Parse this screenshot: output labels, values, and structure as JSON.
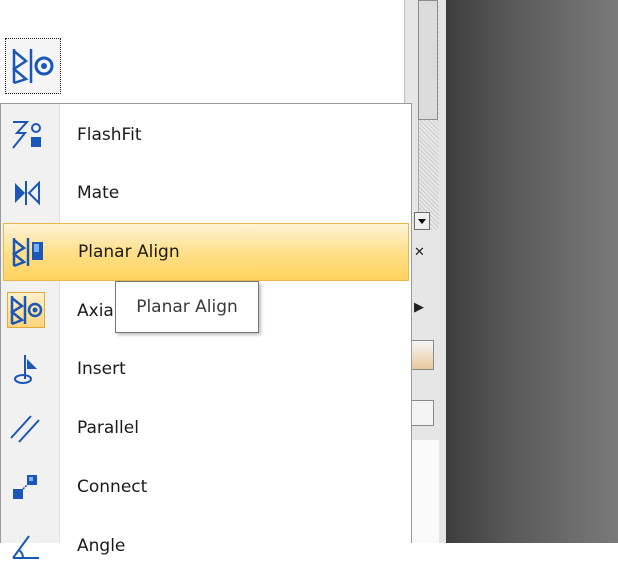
{
  "toolbar": {
    "active_tool_icon": "axial-align-icon"
  },
  "menu": {
    "items": [
      {
        "label": "FlashFit",
        "icon": "flashfit-icon"
      },
      {
        "label": "Mate",
        "icon": "mate-icon"
      },
      {
        "label": "Planar Align",
        "icon": "planar-align-icon"
      },
      {
        "label": "Axia",
        "icon": "axial-align-icon"
      },
      {
        "label": "Insert",
        "icon": "insert-icon"
      },
      {
        "label": "Parallel",
        "icon": "parallel-icon"
      },
      {
        "label": "Connect",
        "icon": "connect-icon"
      },
      {
        "label": "Angle",
        "icon": "angle-icon"
      }
    ],
    "highlighted_index": 2
  },
  "tooltip": {
    "text": "Planar Align"
  },
  "colors": {
    "highlight": "#ffd35e",
    "icon_blue": "#1a57b8",
    "tooltip_border": "#767676"
  }
}
